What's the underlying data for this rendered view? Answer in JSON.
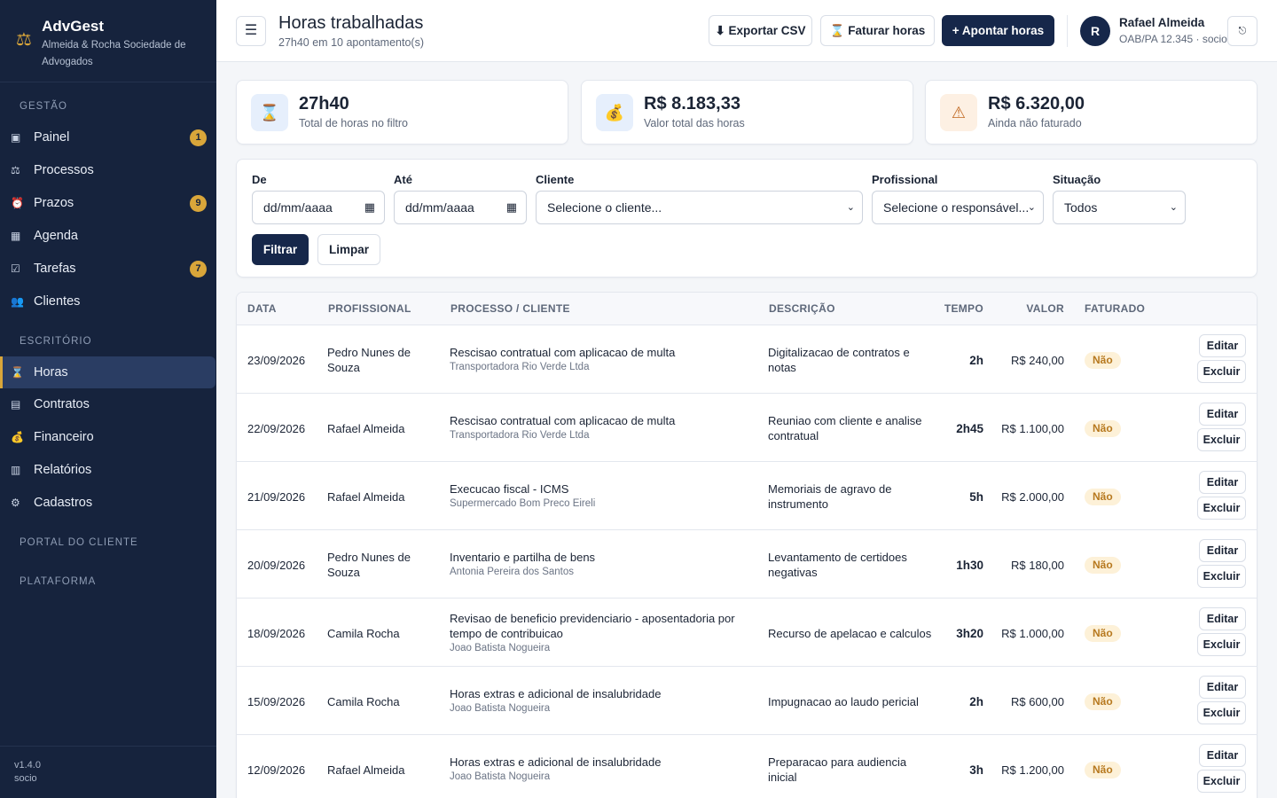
{
  "app": {
    "name": "AdvGest",
    "firm": "Almeida & Rocha Sociedade de Advogados",
    "version": "v1.4.0",
    "role": "socio",
    "logo_icon": "⚖",
    "accent": "#d9a63a",
    "sidebar_bg": "#16233d",
    "primary": "#16274a"
  },
  "nav": {
    "sections": {
      "gestao": "GESTÃO",
      "escritorio": "ESCRITÓRIO",
      "portal": "PORTAL DO CLIENTE",
      "plataforma": "PLATAFORMA"
    },
    "items": [
      {
        "label": "Painel",
        "icon": "▣",
        "badge": "1"
      },
      {
        "label": "Processos",
        "icon": "⚖",
        "badge": ""
      },
      {
        "label": "Prazos",
        "icon": "⏰",
        "badge": "9"
      },
      {
        "label": "Agenda",
        "icon": "▦",
        "badge": ""
      },
      {
        "label": "Tarefas",
        "icon": "☑",
        "badge": "7"
      },
      {
        "label": "Clientes",
        "icon": "👥",
        "badge": ""
      },
      {
        "label": "Horas",
        "icon": "⌛",
        "badge": "",
        "active": true
      },
      {
        "label": "Contratos",
        "icon": "▤",
        "badge": ""
      },
      {
        "label": "Financeiro",
        "icon": "💰",
        "badge": ""
      },
      {
        "label": "Relatórios",
        "icon": "▥",
        "badge": ""
      },
      {
        "label": "Cadastros",
        "icon": "⚙",
        "badge": ""
      }
    ]
  },
  "header": {
    "menu_icon": "☰",
    "title": "Horas trabalhadas",
    "subtitle": "27h40 em 10 apontamento(s)",
    "export_label": "⬇ Exportar CSV",
    "invoice_label": "⌛ Faturar horas",
    "add_label": "+ Apontar horas",
    "user_initial": "R",
    "user_name": "Rafael Almeida",
    "user_role": "OAB/PA 12.345 · socio",
    "logout_icon": "⎋"
  },
  "stats": [
    {
      "icon": "⌛",
      "value": "27h40",
      "label": "Total de horas no filtro",
      "bg": "#e6effc"
    },
    {
      "icon": "💰",
      "value": "R$ 8.183,33",
      "label": "Valor total das horas",
      "bg": "#e6effc"
    },
    {
      "icon": "⚠",
      "value": "R$ 6.320,00",
      "label": "Ainda não faturado",
      "bg": "#fdf0e3"
    }
  ],
  "filters": {
    "de_label": "De",
    "de_placeholder": "dd/mm/aaaa",
    "ate_label": "Até",
    "ate_placeholder": "dd/mm/aaaa",
    "cliente_label": "Cliente",
    "cliente_value": "Selecione o cliente...",
    "profissional_label": "Profissional",
    "profissional_value": "Selecione o responsável...",
    "situacao_label": "Situação",
    "situacao_value": "Todos",
    "filtrar_label": "Filtrar",
    "limpar_label": "Limpar",
    "calendar_icon": "▦",
    "caret_icon": "⌄"
  },
  "table": {
    "headers": {
      "data": "DATA",
      "profissional": "PROFISSIONAL",
      "processo": "PROCESSO / CLIENTE",
      "descricao": "DESCRIÇÃO",
      "tempo": "TEMPO",
      "valor": "VALOR",
      "faturado": "FATURADO"
    },
    "edit_label": "Editar",
    "delete_label": "Excluir",
    "rows": [
      {
        "date": "23/09/2026",
        "prof": "Pedro Nunes de Souza",
        "process": "Rescisao contratual com aplicacao de multa",
        "client": "Transportadora Rio Verde Ltda",
        "desc": "Digitalizacao de contratos e notas",
        "time": "2h",
        "value": "R$ 240,00",
        "billed": "Não"
      },
      {
        "date": "22/09/2026",
        "prof": "Rafael Almeida",
        "process": "Rescisao contratual com aplicacao de multa",
        "client": "Transportadora Rio Verde Ltda",
        "desc": "Reuniao com cliente e analise contratual",
        "time": "2h45",
        "value": "R$ 1.100,00",
        "billed": "Não"
      },
      {
        "date": "21/09/2026",
        "prof": "Rafael Almeida",
        "process": "Execucao fiscal - ICMS",
        "client": "Supermercado Bom Preco Eireli",
        "desc": "Memoriais de agravo de instrumento",
        "time": "5h",
        "value": "R$ 2.000,00",
        "billed": "Não"
      },
      {
        "date": "20/09/2026",
        "prof": "Pedro Nunes de Souza",
        "process": "Inventario e partilha de bens",
        "client": "Antonia Pereira dos Santos",
        "desc": "Levantamento de certidoes negativas",
        "time": "1h30",
        "value": "R$ 180,00",
        "billed": "Não"
      },
      {
        "date": "18/09/2026",
        "prof": "Camila Rocha",
        "process": "Revisao de beneficio previdenciario - aposentadoria por tempo de contribuicao",
        "client": "Joao Batista Nogueira",
        "desc": "Recurso de apelacao e calculos",
        "time": "3h20",
        "value": "R$ 1.000,00",
        "billed": "Não"
      },
      {
        "date": "15/09/2026",
        "prof": "Camila Rocha",
        "process": "Horas extras e adicional de insalubridade",
        "client": "Joao Batista Nogueira",
        "desc": "Impugnacao ao laudo pericial",
        "time": "2h",
        "value": "R$ 600,00",
        "billed": "Não"
      },
      {
        "date": "12/09/2026",
        "prof": "Rafael Almeida",
        "process": "Horas extras e adicional de insalubridade",
        "client": "Joao Batista Nogueira",
        "desc": "Preparacao para audiencia inicial",
        "time": "3h",
        "value": "R$ 1.200,00",
        "billed": "Não"
      }
    ]
  }
}
